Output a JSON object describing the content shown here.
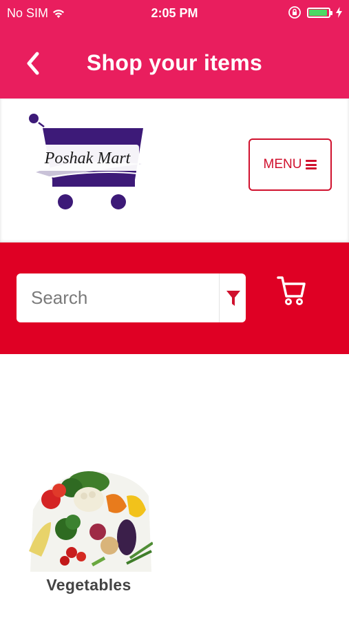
{
  "status_bar": {
    "carrier": "No SIM",
    "time": "2:05 PM",
    "icons": [
      "wifi-icon",
      "orientation-lock-icon",
      "battery-icon",
      "charging-bolt-icon"
    ]
  },
  "nav": {
    "title": "Shop your items",
    "back_icon": "chevron-left-icon"
  },
  "brand": {
    "logo_text": "Poshak Mart",
    "logo_colors": {
      "cart": "#3d1a78",
      "swoosh": "#c9c2d8"
    }
  },
  "header": {
    "menu_label": "MENU",
    "menu_icon": "hamburger-icon"
  },
  "search": {
    "placeholder": "Search",
    "value": "",
    "filter_icon": "filter-icon",
    "cart_icon": "shopping-cart-icon"
  },
  "categories": [
    {
      "label": "Vegetables",
      "image": "vegetables-photo"
    }
  ],
  "colors": {
    "navbar": "#e91e5e",
    "search_band": "#df0024",
    "accent": "#d0102d",
    "battery": "#4cd964"
  }
}
